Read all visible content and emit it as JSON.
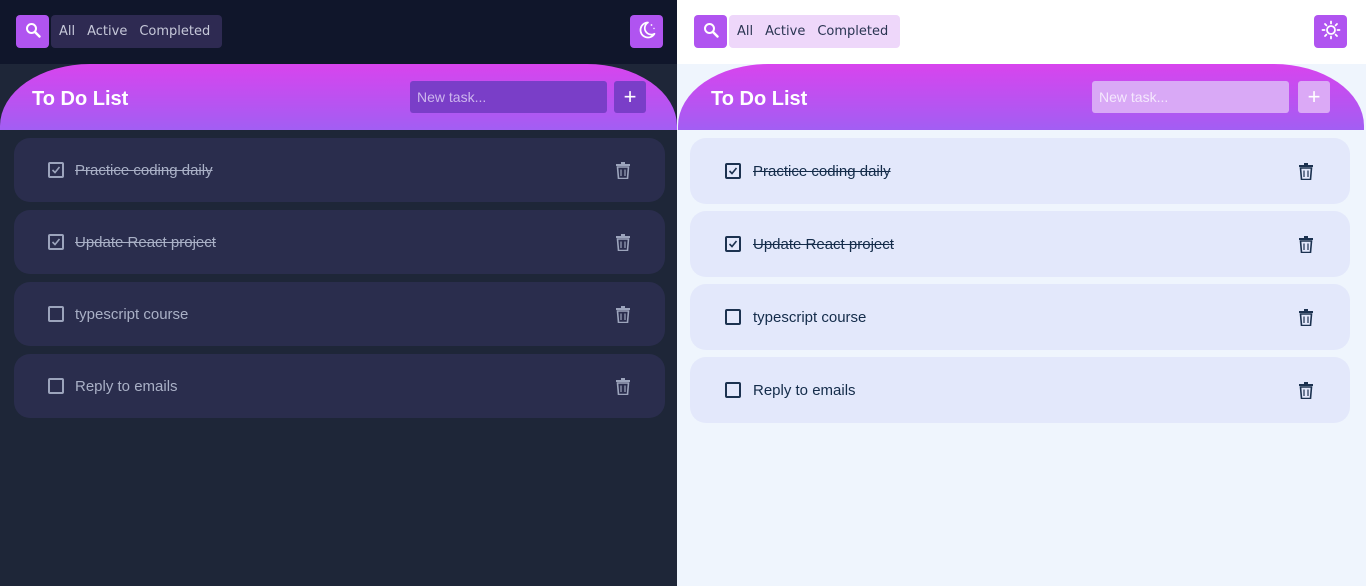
{
  "filters": [
    "All",
    "Active",
    "Completed"
  ],
  "header_title": "To Do List",
  "new_task_placeholder": "New task...",
  "add_label": "+",
  "tasks": [
    {
      "text": "Practice coding daily",
      "completed": true
    },
    {
      "text": "Update React project",
      "completed": true
    },
    {
      "text": "typescript course",
      "completed": false
    },
    {
      "text": "Reply to emails",
      "completed": false
    }
  ],
  "panes": [
    {
      "theme": "dark",
      "theme_icon": "moon-icon"
    },
    {
      "theme": "light",
      "theme_icon": "sun-icon"
    }
  ],
  "colors": {
    "accent": "#b054f0",
    "gradient_top": "#d844ee",
    "gradient_bottom": "#a25ef3",
    "dark_bg": "#1e2638",
    "light_bg": "#eff5fd"
  }
}
